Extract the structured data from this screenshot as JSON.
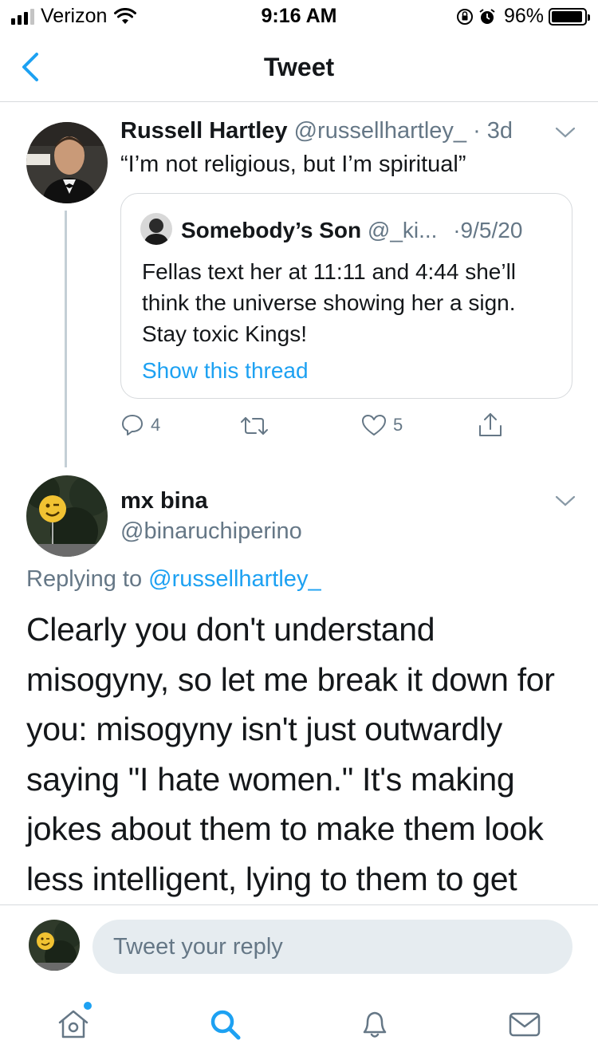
{
  "status_bar": {
    "carrier": "Verizon",
    "time": "9:16 AM",
    "battery": "96%",
    "battery_level": 0.96
  },
  "header": {
    "title": "Tweet",
    "back_icon": "chevron-left-icon"
  },
  "tweet": {
    "author_name": "Russell Hartley",
    "author_handle": "@russellhartley_",
    "time": "· 3d",
    "text": "“I’m not religious, but I’m spiritual”",
    "quoted": {
      "author_name": "Somebody’s Son",
      "author_handle": "@_ki...",
      "date": "·9/5/20",
      "text": "Fellas text her at 11:11 and 4:44 she’ll think the universe showing her a sign. Stay toxic Kings!",
      "show_thread": "Show this thread"
    },
    "actions": {
      "reply_count": "4",
      "retweet_count": "",
      "like_count": "5"
    }
  },
  "reply": {
    "author_name": "mx bina",
    "author_handle": "@binaruchiperino",
    "replying_prefix": "Replying to",
    "replying_to": "@russellhartley_",
    "text": "Clearly you don't understand misogyny, so let me break it down for you: misogyny isn't just outwardly saying \"I hate women.\" It's making jokes about them to make them look less intelligent, lying to them to get"
  },
  "reply_bar": {
    "placeholder": "Tweet your reply"
  },
  "tab_bar": {
    "items": [
      "home-icon",
      "search-icon",
      "bell-icon",
      "mail-icon"
    ],
    "home_has_notification": true
  },
  "colors": {
    "accent": "#1da1f2",
    "text": "#14171a",
    "secondary": "#657786",
    "border": "#d7dadd",
    "input_bg": "#e6ecf0"
  }
}
